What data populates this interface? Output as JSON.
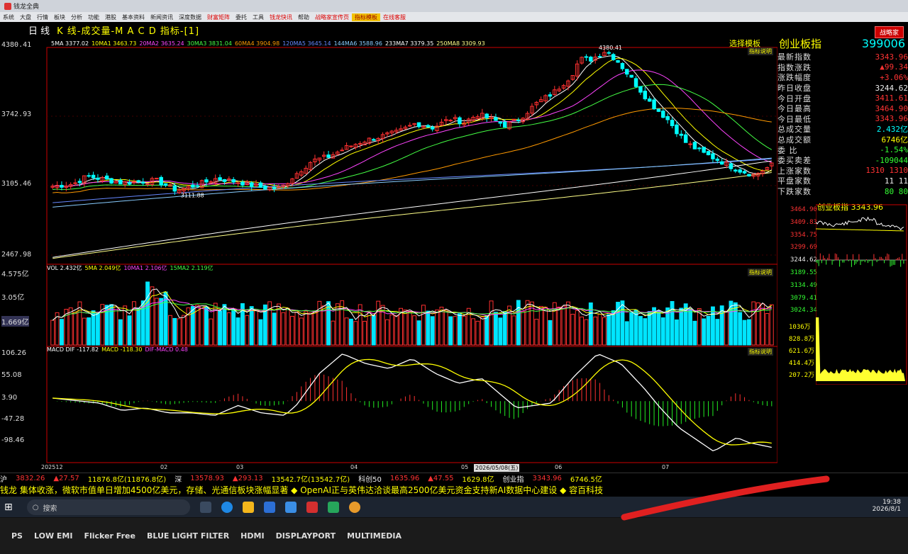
{
  "window": {
    "title": "钱龙全典"
  },
  "menu": {
    "items": [
      "系统",
      "大盘",
      "行情",
      "板块",
      "分析",
      "功能",
      "港股",
      "基本资料",
      "新闻资讯",
      "深度数据",
      "财富矩阵",
      "委托",
      "工具",
      "钱龙快讯",
      "帮助",
      "战略家宣传页",
      "指标模板",
      "在线客服"
    ],
    "red_items": [
      "财富矩阵",
      "钱龙快讯",
      "战略家宣传页",
      "在线客服"
    ],
    "highlight_item": "指标模板"
  },
  "brand_badge": "战略家",
  "chart_header": {
    "period": "日 线",
    "title": "K 线-成交量-M A C D 指标-[1]"
  },
  "price_panel": {
    "ma_legend": [
      {
        "text": "5MA 3377.02",
        "color": "#ffffff"
      },
      {
        "text": "10MA1 3463.73",
        "color": "#ffff00"
      },
      {
        "text": "20MA2 3635.24",
        "color": "#ff44ff"
      },
      {
        "text": "30MA3 3831.04",
        "color": "#44ff44"
      },
      {
        "text": "60MA4 3904.98",
        "color": "#ff9900"
      },
      {
        "text": "120MA5 3645.14",
        "color": "#6688ff"
      },
      {
        "text": "144MA6 3588.96",
        "color": "#88ccff"
      },
      {
        "text": "233MA7 3379.35",
        "color": "#ffffff"
      },
      {
        "text": "250MA8 3309.93",
        "color": "#ffff88"
      }
    ],
    "y_labels": [
      "4380.41",
      "3742.93",
      "3105.46",
      "2467.98"
    ],
    "high_label": "4380.41",
    "low_label": "3111.88",
    "note": "指标说明"
  },
  "volume_panel": {
    "legend": [
      {
        "text": "VOL 2.432亿",
        "color": "#ffffff"
      },
      {
        "text": "5MA 2.049亿",
        "color": "#ffff00"
      },
      {
        "text": "10MA1 2.106亿",
        "color": "#ff44ff"
      },
      {
        "text": "15MA2 2.119亿",
        "color": "#44ff44"
      }
    ],
    "y_labels": [
      "4.575亿",
      "3.05亿",
      "1.669亿"
    ],
    "note": "指标说明"
  },
  "macd_panel": {
    "legend": [
      {
        "text": "MACD DIF -117.82",
        "color": "#ffffff"
      },
      {
        "text": "MACD -118.30",
        "color": "#ffff00"
      },
      {
        "text": "DIF-MACD 0.48",
        "color": "#ff44ff"
      }
    ],
    "y_labels": [
      "106.26",
      "55.08",
      "3.90",
      "-47.28",
      "-98.46"
    ],
    "note": "指标说明"
  },
  "x_axis": {
    "labels": [
      "202512",
      "02",
      "03",
      "04",
      "05",
      "2026/05/08(五)",
      "06",
      "07"
    ]
  },
  "right_panel": {
    "selector": "选择模板",
    "index_name": "创业板指",
    "index_code": "399006",
    "stats": [
      {
        "k": "最新指数",
        "v": "3343.96",
        "c": "red"
      },
      {
        "k": "指数涨跌",
        "v": "▲99.34",
        "c": "red"
      },
      {
        "k": "涨跌幅度",
        "v": "+3.06%",
        "c": "red"
      },
      {
        "k": "昨日收盘",
        "v": "3244.62",
        "c": "wh"
      },
      {
        "k": "今日开盘",
        "v": "3411.61",
        "c": "red"
      },
      {
        "k": "今日最高",
        "v": "3464.90",
        "c": "red"
      },
      {
        "k": "今日最低",
        "v": "3343.96",
        "c": "red"
      },
      {
        "k": "总成交量",
        "v": "2.432亿",
        "c": "cy"
      },
      {
        "k": "总成交额",
        "v": "6746亿",
        "c": "yel"
      },
      {
        "k": "委 比",
        "v": "-1.54%",
        "c": "grn"
      },
      {
        "k": "委买卖差",
        "v": "-109044",
        "c": "grn"
      },
      {
        "k": "上涨家数",
        "v": "1310    1310",
        "c": "red"
      },
      {
        "k": "平盘家数",
        "v": "11      11",
        "c": "wh"
      },
      {
        "k": "下跌家数",
        "v": "80      80",
        "c": "grn"
      }
    ],
    "mini_title": "创业板指 3343.96",
    "mini_y": [
      "3464.90",
      "3409.83",
      "3354.75",
      "3299.69",
      "3244.62",
      "3189.55",
      "3134.49",
      "3079.41",
      "3024.34"
    ],
    "mini_vol_y": [
      "1036万",
      "828.8万",
      "621.6万",
      "414.4万",
      "207.2万"
    ]
  },
  "ticker": [
    {
      "text": "沪",
      "c": "wh"
    },
    {
      "text": "3832.26",
      "c": "red"
    },
    {
      "text": "▲27.57",
      "c": "red"
    },
    {
      "text": "11876.8亿(11876.8亿)",
      "c": "yel"
    },
    {
      "text": "深",
      "c": "wh"
    },
    {
      "text": "13578.93",
      "c": "red"
    },
    {
      "text": "▲293.13",
      "c": "red"
    },
    {
      "text": "13542.7亿(13542.7亿)",
      "c": "yel"
    },
    {
      "text": "科创50",
      "c": "wh"
    },
    {
      "text": "1635.96",
      "c": "red"
    },
    {
      "text": "▲47.55",
      "c": "red"
    },
    {
      "text": "1629.8亿",
      "c": "yel"
    },
    {
      "text": "创业指",
      "c": "wh"
    },
    {
      "text": "3343.96",
      "c": "red"
    },
    {
      "text": "6746.5亿",
      "c": "yel"
    }
  ],
  "news": "钱龙 集体收涨，微软市值单日增加4500亿美元，存储、光通信板块涨幅显著 ◆ OpenAI正与英伟达洽谈最高2500亿美元资金支持新AI数据中心建设 ◆ 容百科技",
  "taskbar": {
    "search_placeholder": "搜索",
    "time": "19:38",
    "date": "2026/8/1"
  },
  "bezel": [
    "PS",
    "LOW EMI",
    "Flicker Free",
    "BLUE LIGHT FILTER",
    "HDMI",
    "DISPLAYPORT",
    "MULTIMEDIA"
  ]
}
